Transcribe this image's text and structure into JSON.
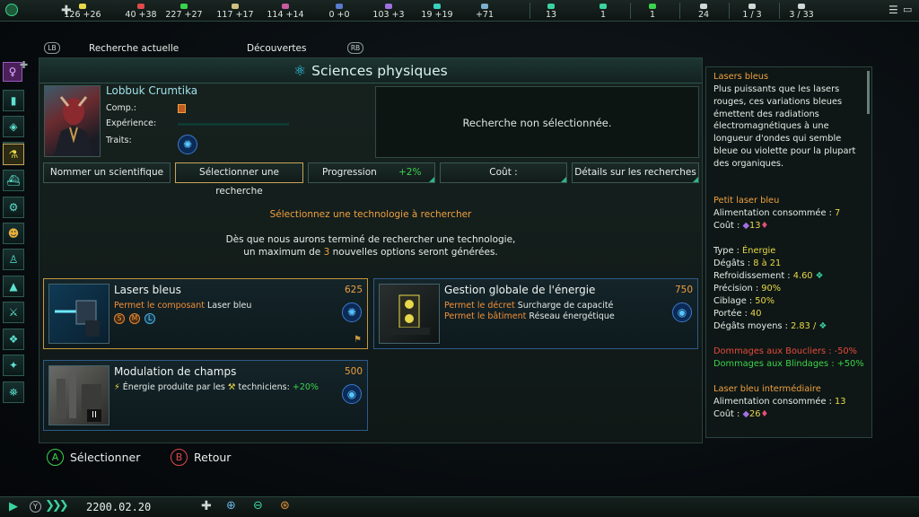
{
  "topbar": {
    "resources": [
      {
        "icon": "energy-icon",
        "value": "126 +26",
        "color": "#e8d84a"
      },
      {
        "icon": "minerals-icon",
        "value": "40 +38",
        "color": "#e04a4a"
      },
      {
        "icon": "food-icon",
        "value": "227 +27",
        "color": "#3bd34c"
      },
      {
        "icon": "consumer-goods-icon",
        "value": "117 +17",
        "color": "#d0c080"
      },
      {
        "icon": "alloys-icon",
        "value": "114 +14",
        "color": "#c85aa0"
      },
      {
        "icon": "strategic-resource-icon",
        "value": "0 +0",
        "color": "#5a7ad0"
      },
      {
        "icon": "influence-icon",
        "value": "103 +3",
        "color": "#a070e0"
      },
      {
        "icon": "unity-icon",
        "value": "19 +19",
        "color": "#3ad0c0"
      },
      {
        "icon": "research-icon",
        "value": "+71",
        "color": "#7ab0d0"
      },
      {
        "icon": "pop-icon",
        "value": "13",
        "color": "#3bd3a0"
      },
      {
        "icon": "fleet-icon",
        "value": "1",
        "color": "#3bd3a0"
      },
      {
        "icon": "planet-icon",
        "value": "1",
        "color": "#3bd34c"
      },
      {
        "icon": "naval-capacity-icon",
        "value": "24",
        "color": "#cfd8d4"
      },
      {
        "icon": "starbase-icon",
        "value": "1 / 3",
        "color": "#cfd8d4"
      },
      {
        "icon": "systems-icon",
        "value": "3 / 33",
        "color": "#cfd8d4"
      }
    ]
  },
  "tabs": {
    "lb": "LB",
    "current": "Recherche actuelle",
    "discoveries": "Découvertes",
    "rb": "RB"
  },
  "panel": {
    "title": "Sciences physiques",
    "scientist_name": "Lobbuk Crumtika",
    "comp_label": "Comp.:",
    "exp_label": "Expérience:",
    "traits_label": "Traits:",
    "no_research": "Recherche non sélectionnée.",
    "buttons": {
      "name_scientist": "Nommer un scientifique",
      "select_research": "Sélectionner une recherche",
      "progress": "Progression",
      "progress_value": "+2%",
      "cost": "Coût :",
      "details": "Détails sur les recherches"
    },
    "select_prompt": "Sélectionnez une technologie à rechercher",
    "info_line1": "Dès que nous aurons terminé de rechercher une technologie,",
    "info_line2_pre": "un maximum de",
    "info_line2_num": "3",
    "info_line2_post": "nouvelles options seront générées."
  },
  "techs": [
    {
      "title": "Lasers bleus",
      "cost": "625",
      "line1_prefix": "Permet le composant",
      "line1_value": "Laser bleu",
      "slots": [
        "S",
        "M",
        "L"
      ]
    },
    {
      "title": "Gestion globale de l'énergie",
      "cost": "750",
      "line1_prefix": "Permet le décret",
      "line1_value": "Surcharge de capacité",
      "line2_prefix": "Permet le bâtiment",
      "line2_value": "Réseau énergétique"
    },
    {
      "title": "Modulation de champs",
      "cost": "500",
      "line1_prefix": "Énergie produite par les",
      "line1_value": "techniciens:",
      "line1_bonus": "+20%",
      "tier": "II"
    }
  ],
  "info": {
    "title": "Lasers bleus",
    "desc": "Plus puissants que les lasers rouges, ces variations bleues émettent des radiations électromagnétiques à une longueur d'ondes qui semble bleue ou violette pour la plupart des organiques.",
    "small_title": "Petit laser bleu",
    "power_label": "Alimentation consommée :",
    "power_value": "7",
    "cost_label": "Coût :",
    "cost_value": "13",
    "type_label": "Type :",
    "type_value": "Énergie",
    "damage_label": "Dégâts :",
    "damage_value": "8 à 21",
    "cooldown_label": "Refroidissement :",
    "cooldown_value": "4.60",
    "accuracy_label": "Précision :",
    "accuracy_value": "90%",
    "tracking_label": "Ciblage :",
    "tracking_value": "50%",
    "range_label": "Portée :",
    "range_value": "40",
    "avg_label": "Dégâts moyens :",
    "avg_value": "2.83 /",
    "shields": "Dommages aux Boucliers : -50%",
    "armor": "Dommages aux Blindages : +50%",
    "medium_title": "Laser bleu intermédiaire",
    "medium_power_value": "13",
    "medium_cost_value": "26"
  },
  "bottom": {
    "select_btn": "A",
    "select_label": "Sélectionner",
    "back_btn": "B",
    "back_label": "Retour",
    "date": "2200.02.20",
    "y_btn": "Y"
  }
}
